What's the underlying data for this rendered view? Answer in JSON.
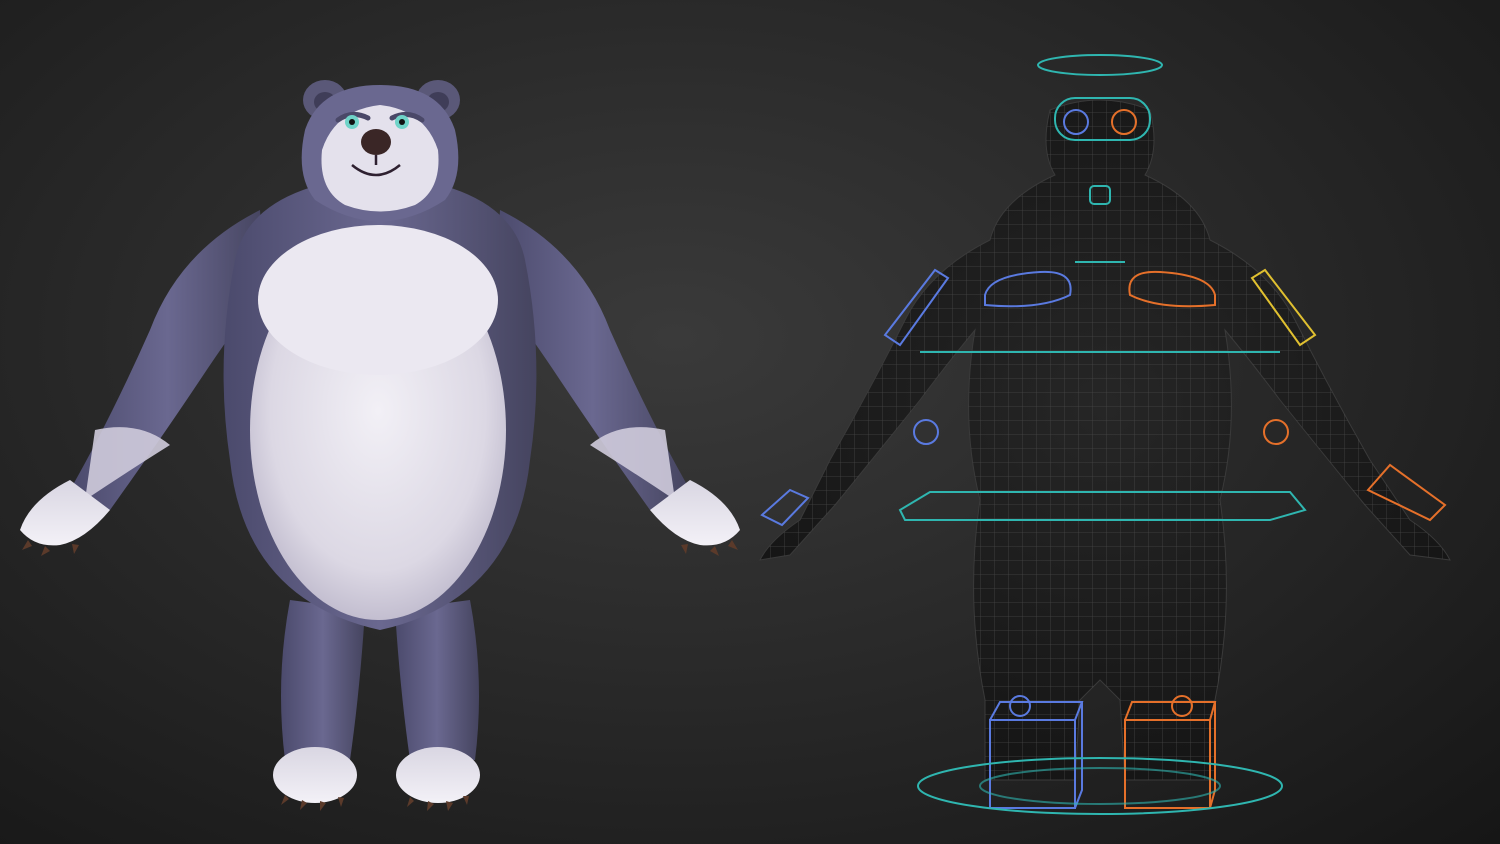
{
  "scene": {
    "subject": "bear",
    "views": [
      {
        "id": "rendered",
        "icon": "bear-render"
      },
      {
        "id": "rig",
        "icon": "bear-wireframe-rig"
      }
    ]
  },
  "colors": {
    "background": "#2a2a2a",
    "fur_dark": "#5a5878",
    "fur_light": "#e9e6ef",
    "nose": "#3a2626",
    "eye": "#6fd3c8",
    "claw": "#5b3a2a",
    "wire": "#4a4a4a",
    "rig_cyan": "#2fb6b0",
    "rig_blue": "#5a7ae0",
    "rig_orange": "#e5702a",
    "rig_yellow": "#e0c030"
  }
}
